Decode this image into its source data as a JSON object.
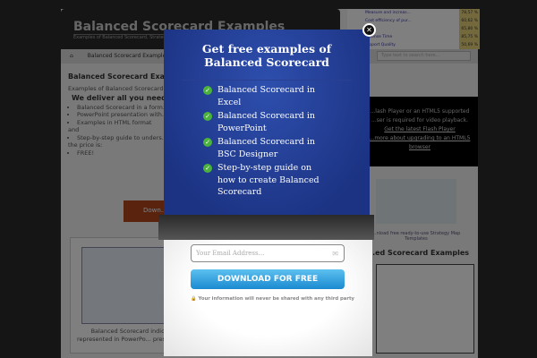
{
  "site": {
    "title": "Balanced Scorecard Examples",
    "tagline": "Examples of Balanced Scorecard, Strategy Maps and KPIs",
    "breadcrumb": "Balanced Scorecard Examples",
    "search_placeholder": "Type text to search here..."
  },
  "kpis": [
    {
      "name": "Measure and increas...",
      "value": "78,57 %"
    },
    {
      "name": "Cost efficiency of pur...",
      "value": "60,62 %"
    },
    {
      "name": "...r",
      "value": "65,80 %"
    },
    {
      "name": "...ponse Time",
      "value": "85,75 %"
    },
    {
      "name": "...pport Quality",
      "value": "50,69 %"
    }
  ],
  "main": {
    "heading": "Balanced Scorecard Exam...",
    "intro": "Examples of Balanced Scorecard t... download and use!",
    "deliver": "We deliver all you need to...",
    "items": [
      "Balanced Scorecard in a form... spreadsheet",
      "PowerPoint presentation with... Balanced Scorecard examples",
      "Examples in HTML format"
    ],
    "and": "and",
    "items2": [
      "Step-by-step guide to unders..."
    ],
    "price": "the price is:",
    "items3": [
      "FREE!"
    ],
    "download": "Down...",
    "thumb_caption": "Balanced Scorecard indicat... represented in PowerPo... presentation"
  },
  "sidebar": {
    "video_text": "...lash Player or an HTML5 supported ...ser is required for video playback.",
    "video_link1": "Get the latest Flash Player",
    "video_link2": "...more about upgrading to an HTML5 browser",
    "strategy_caption": "...nload free ready-to-use Strategy Map Templates",
    "bsc_heading": "...ed Scorecard Examples"
  },
  "modal": {
    "title": "Get free examples of Balanced Scorecard",
    "items": [
      "Balanced Scorecard in Excel",
      "Balanced Scorecard in PowerPoint",
      "Balanced Scorecard in BSC Designer",
      "Step-by-step guide on how to create Balanced Scorecard"
    ],
    "email_placeholder": "Your Email Address...",
    "button": "DOWNLOAD FOR FREE",
    "privacy": "Your information will never be shared with any third party"
  }
}
